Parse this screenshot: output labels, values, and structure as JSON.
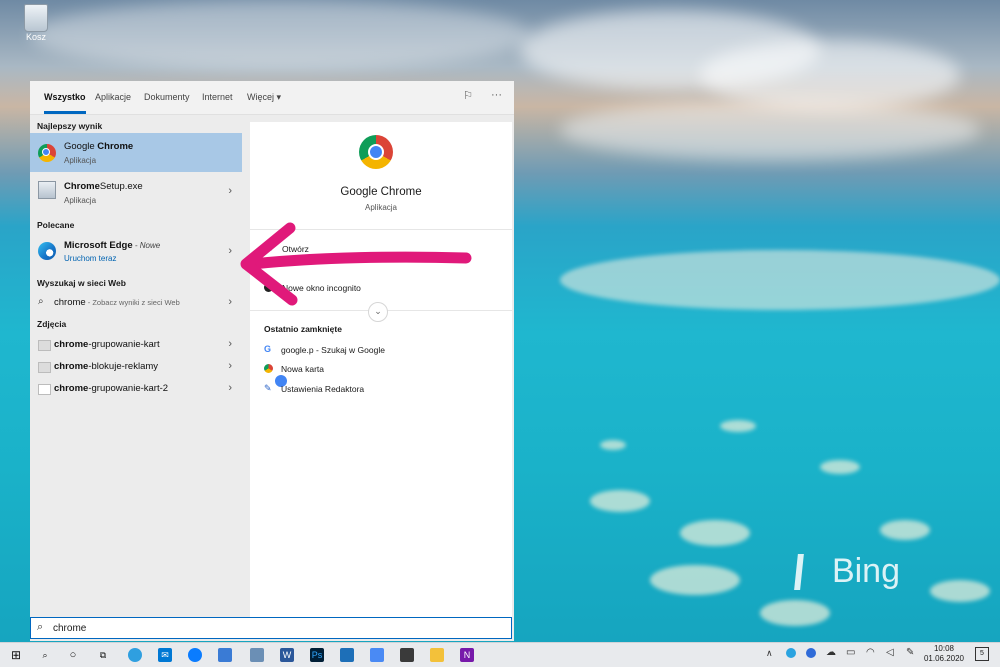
{
  "desktop": {
    "recycle_label": "Kosz",
    "bing_label": "Bing"
  },
  "tabs": [
    {
      "label": "Wszystko",
      "active": true
    },
    {
      "label": "Aplikacje"
    },
    {
      "label": "Dokumenty"
    },
    {
      "label": "Internet"
    },
    {
      "label": "Więcej"
    }
  ],
  "sections": {
    "best": "Najlepszy wynik",
    "recommended": "Polecane",
    "web": "Wyszukaj w sieci Web",
    "photos": "Zdjęcia"
  },
  "best_result": {
    "title_plain": "Google ",
    "title_bold": "Chrome",
    "sub": "Aplikacja"
  },
  "setup": {
    "title_bold": "Chrome",
    "title_plain": "Setup.exe",
    "sub": "Aplikacja"
  },
  "edge": {
    "title": "Microsoft Edge",
    "tag": " - Nowe",
    "sub": "Uruchom teraz"
  },
  "web_result": {
    "query": "chrome",
    "suffix": " - Zobacz wyniki z sieci Web"
  },
  "photos": [
    {
      "bold": "chrome",
      "rest": "-grupowanie-kart"
    },
    {
      "bold": "chrome",
      "rest": "-blokuje-reklamy"
    },
    {
      "bold": "chrome",
      "rest": "-grupowanie-kart-2"
    }
  ],
  "preview": {
    "title": "Google Chrome",
    "sub": "Aplikacja",
    "actions": [
      "Otwórz",
      "Nowe okno incognito"
    ],
    "recent_heading": "Ostatnio zamknięte",
    "recent": [
      "google.p - Szukaj w Google",
      "Nowa karta",
      "Ustawienia Redaktora"
    ]
  },
  "search": {
    "value": "chrome"
  },
  "clock": {
    "time": "10:08",
    "date": "01.06.2020"
  },
  "notification_count": "5",
  "colors": {
    "accent": "#0067c0",
    "selected": "#a8c8e6",
    "arrow": "#e0197a"
  }
}
